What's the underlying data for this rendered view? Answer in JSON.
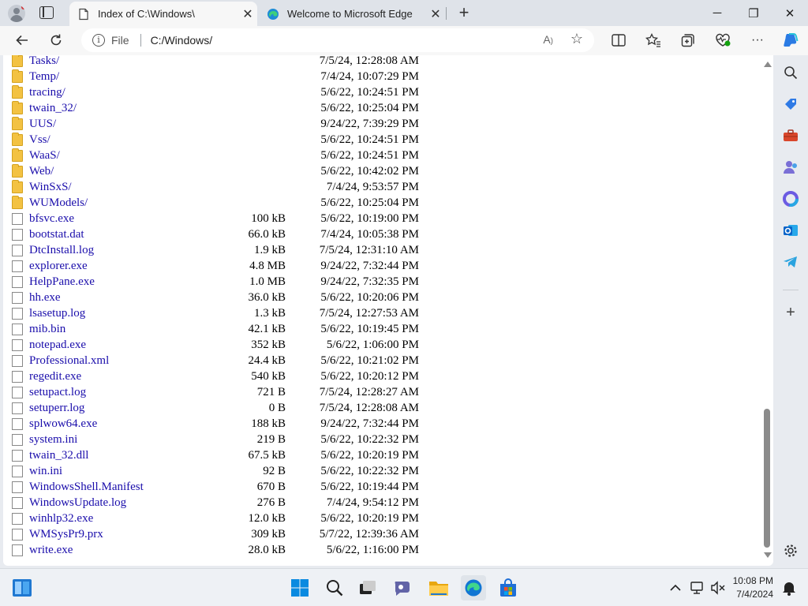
{
  "browser": {
    "tabs": [
      {
        "title": "Index of C:\\Windows\\",
        "active": true
      },
      {
        "title": "Welcome to Microsoft Edge",
        "active": false
      }
    ],
    "new_tab": "+",
    "address": {
      "scheme_label": "File",
      "url": "C:/Windows/"
    },
    "window_controls": {
      "minimize": "─",
      "restore": "❐",
      "close": "✕"
    }
  },
  "listing": [
    {
      "type": "folder",
      "name": "Tasks/",
      "size": "",
      "date": "7/5/24, 12:28:08 AM"
    },
    {
      "type": "folder",
      "name": "Temp/",
      "size": "",
      "date": "7/4/24, 10:07:29 PM"
    },
    {
      "type": "folder",
      "name": "tracing/",
      "size": "",
      "date": "5/6/22, 10:24:51 PM"
    },
    {
      "type": "folder",
      "name": "twain_32/",
      "size": "",
      "date": "5/6/22, 10:25:04 PM"
    },
    {
      "type": "folder",
      "name": "UUS/",
      "size": "",
      "date": "9/24/22, 7:39:29 PM"
    },
    {
      "type": "folder",
      "name": "Vss/",
      "size": "",
      "date": "5/6/22, 10:24:51 PM"
    },
    {
      "type": "folder",
      "name": "WaaS/",
      "size": "",
      "date": "5/6/22, 10:24:51 PM"
    },
    {
      "type": "folder",
      "name": "Web/",
      "size": "",
      "date": "5/6/22, 10:42:02 PM"
    },
    {
      "type": "folder",
      "name": "WinSxS/",
      "size": "",
      "date": "7/4/24, 9:53:57 PM"
    },
    {
      "type": "folder",
      "name": "WUModels/",
      "size": "",
      "date": "5/6/22, 10:25:04 PM"
    },
    {
      "type": "file",
      "name": "bfsvc.exe",
      "size": "100 kB",
      "date": "5/6/22, 10:19:00 PM"
    },
    {
      "type": "file",
      "name": "bootstat.dat",
      "size": "66.0 kB",
      "date": "7/4/24, 10:05:38 PM"
    },
    {
      "type": "file",
      "name": "DtcInstall.log",
      "size": "1.9 kB",
      "date": "7/5/24, 12:31:10 AM"
    },
    {
      "type": "file",
      "name": "explorer.exe",
      "size": "4.8 MB",
      "date": "9/24/22, 7:32:44 PM"
    },
    {
      "type": "file",
      "name": "HelpPane.exe",
      "size": "1.0 MB",
      "date": "9/24/22, 7:32:35 PM"
    },
    {
      "type": "file",
      "name": "hh.exe",
      "size": "36.0 kB",
      "date": "5/6/22, 10:20:06 PM"
    },
    {
      "type": "file",
      "name": "lsasetup.log",
      "size": "1.3 kB",
      "date": "7/5/24, 12:27:53 AM"
    },
    {
      "type": "file",
      "name": "mib.bin",
      "size": "42.1 kB",
      "date": "5/6/22, 10:19:45 PM"
    },
    {
      "type": "file",
      "name": "notepad.exe",
      "size": "352 kB",
      "date": "5/6/22, 1:06:00 PM"
    },
    {
      "type": "file",
      "name": "Professional.xml",
      "size": "24.4 kB",
      "date": "5/6/22, 10:21:02 PM"
    },
    {
      "type": "file",
      "name": "regedit.exe",
      "size": "540 kB",
      "date": "5/6/22, 10:20:12 PM"
    },
    {
      "type": "file",
      "name": "setupact.log",
      "size": "721 B",
      "date": "7/5/24, 12:28:27 AM"
    },
    {
      "type": "file",
      "name": "setuperr.log",
      "size": "0 B",
      "date": "7/5/24, 12:28:08 AM"
    },
    {
      "type": "file",
      "name": "splwow64.exe",
      "size": "188 kB",
      "date": "9/24/22, 7:32:44 PM"
    },
    {
      "type": "file",
      "name": "system.ini",
      "size": "219 B",
      "date": "5/6/22, 10:22:32 PM"
    },
    {
      "type": "file",
      "name": "twain_32.dll",
      "size": "67.5 kB",
      "date": "5/6/22, 10:20:19 PM"
    },
    {
      "type": "file",
      "name": "win.ini",
      "size": "92 B",
      "date": "5/6/22, 10:22:32 PM"
    },
    {
      "type": "file",
      "name": "WindowsShell.Manifest",
      "size": "670 B",
      "date": "5/6/22, 10:19:44 PM"
    },
    {
      "type": "file",
      "name": "WindowsUpdate.log",
      "size": "276 B",
      "date": "7/4/24, 9:54:12 PM"
    },
    {
      "type": "file",
      "name": "winhlp32.exe",
      "size": "12.0 kB",
      "date": "5/6/22, 10:20:19 PM"
    },
    {
      "type": "file",
      "name": "WMSysPr9.prx",
      "size": "309 kB",
      "date": "5/7/22, 12:39:36 AM"
    },
    {
      "type": "file",
      "name": "write.exe",
      "size": "28.0 kB",
      "date": "5/6/22, 1:16:00 PM"
    }
  ],
  "sidebar_icons": [
    "search-icon",
    "shopping-tag-icon",
    "toolbox-icon",
    "persona-icon",
    "m365-icon",
    "outlook-icon",
    "telegram-icon",
    "add-icon",
    "settings-icon"
  ],
  "taskbar": {
    "apps": [
      "widgets-icon",
      "windows-start-icon",
      "search-icon",
      "task-view-icon",
      "teams-chat-icon",
      "file-explorer-icon",
      "edge-icon",
      "store-icon"
    ],
    "clock_time": "10:08 PM",
    "clock_date": "7/4/2024"
  },
  "colors": {
    "link": "#1a0dab",
    "folder": "#f3c242",
    "accent": "#0078d4"
  }
}
